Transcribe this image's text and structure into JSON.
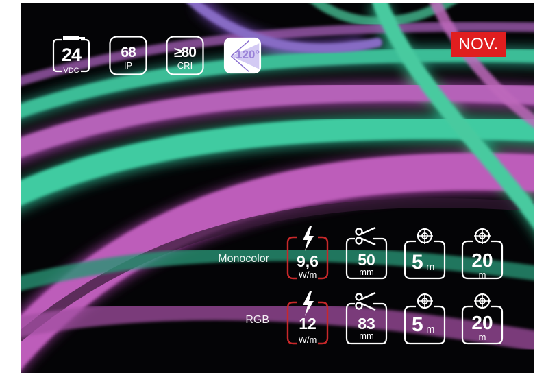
{
  "badges": {
    "voltage": {
      "value": "24",
      "unit": "VDC"
    },
    "ip": {
      "value": "68",
      "unit": "IP"
    },
    "cri": {
      "value": "≥80",
      "unit": "CRI"
    },
    "beam_angle": {
      "value": "120°"
    }
  },
  "tag": "NOV.",
  "rows": [
    {
      "label": "Monocolor",
      "power": {
        "value": "9,6",
        "unit": "W/m"
      },
      "cut": {
        "value": "50",
        "unit": "mm"
      },
      "min_length": {
        "value": "5",
        "unit": "m"
      },
      "max_length": {
        "value": "20",
        "unit": "m"
      }
    },
    {
      "label": "RGB",
      "power": {
        "value": "12",
        "unit": "W/m"
      },
      "cut": {
        "value": "83",
        "unit": "mm"
      },
      "min_length": {
        "value": "5",
        "unit": "m"
      },
      "max_length": {
        "value": "20",
        "unit": "m"
      }
    }
  ],
  "icons": {
    "power": "lightning-icon",
    "cut": "scissors-icon",
    "length": "reel-icon",
    "voltage": "plug-icon",
    "angle": "beam-angle-icon"
  },
  "colors": {
    "background": "#050507",
    "neon_green": "#3ee8b0",
    "neon_pink": "#d866d6",
    "accent_red": "#e01e1f",
    "power_frame": "#c8282a"
  }
}
